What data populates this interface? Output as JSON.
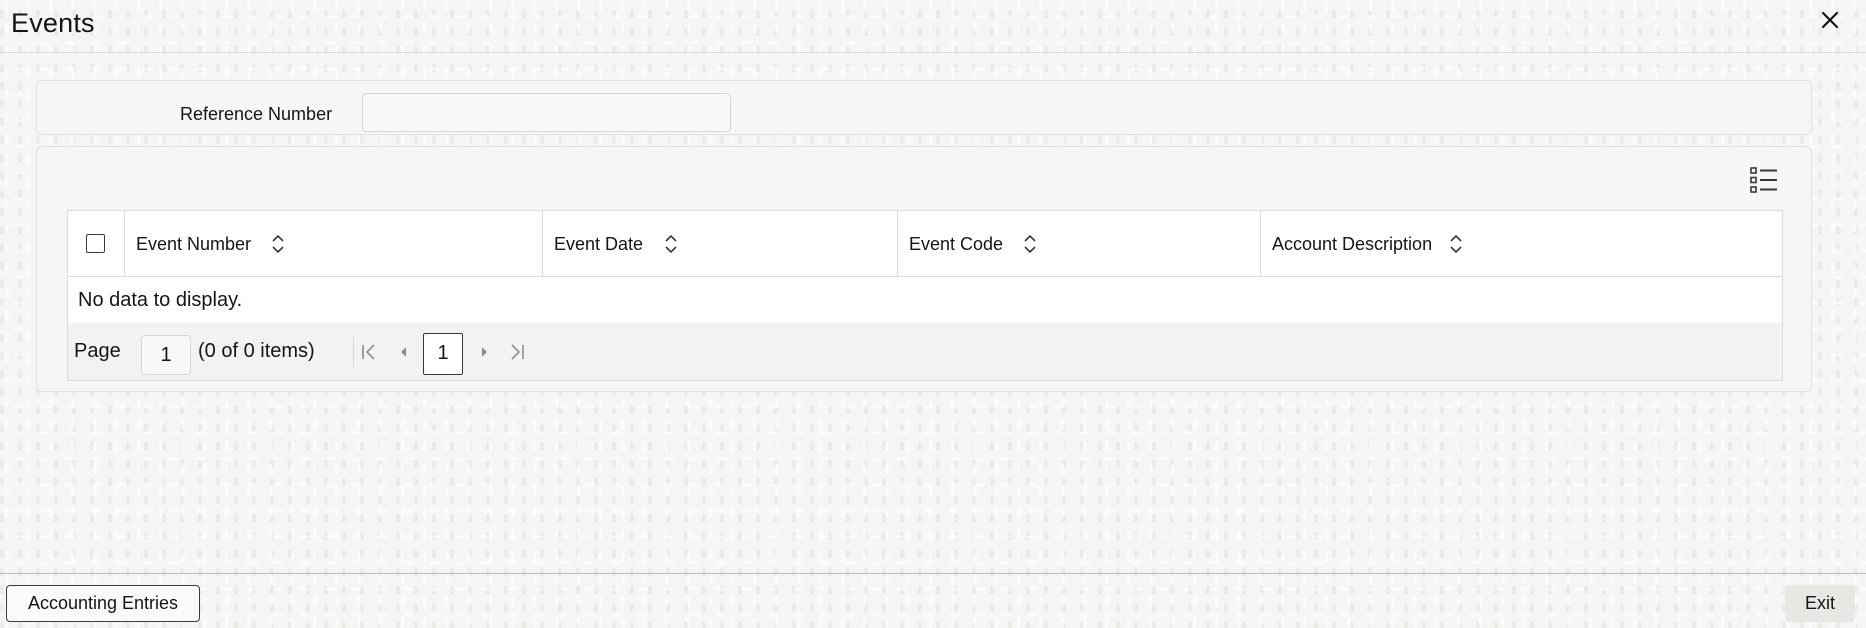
{
  "window": {
    "title": "Events",
    "close_icon": "close-icon"
  },
  "reference": {
    "label": "Reference Number",
    "value": "",
    "placeholder": ""
  },
  "grid": {
    "view_icon": "list-view-icon",
    "columns": [
      {
        "label": "Event Number",
        "sortable": true
      },
      {
        "label": "Event Date",
        "sortable": true
      },
      {
        "label": "Event Code",
        "sortable": true
      },
      {
        "label": "Account Description",
        "sortable": true
      }
    ],
    "rows": [],
    "empty_message": "No data to display.",
    "pagination": {
      "page_label": "Page",
      "page_value": "1",
      "count_text": "(0 of 0 items)",
      "current_page": "1"
    }
  },
  "footer": {
    "accounting_entries_label": "Accounting Entries",
    "exit_label": "Exit"
  }
}
